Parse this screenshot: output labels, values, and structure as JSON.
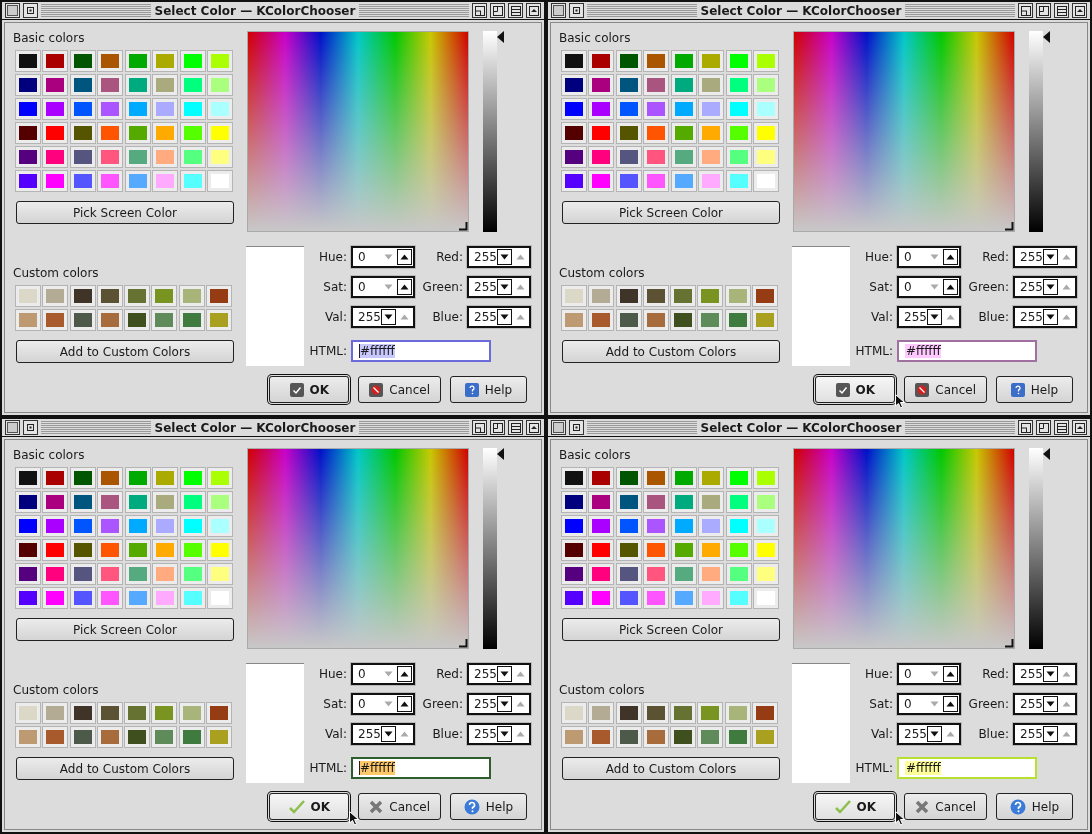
{
  "dialogs": [
    {
      "title": "Select Color — KColorChooser",
      "basic_label": "Basic colors",
      "basic_colors": [
        {
          "color": "#111111"
        },
        {
          "color": "#aa0000"
        },
        {
          "color": "#005500"
        },
        {
          "color": "#aa5500"
        },
        {
          "color": "#00aa00"
        },
        {
          "color": "#aaaa00"
        },
        {
          "color": "#00ff00"
        },
        {
          "color": "#aaff00"
        },
        {
          "color": "#00007f"
        },
        {
          "color": "#aa007f"
        },
        {
          "color": "#00557f"
        },
        {
          "color": "#aa557f"
        },
        {
          "color": "#00aa7f"
        },
        {
          "color": "#aaaa7f"
        },
        {
          "color": "#00ff7f"
        },
        {
          "color": "#aaff7f"
        },
        {
          "color": "#0000ff"
        },
        {
          "color": "#aa00ff"
        },
        {
          "color": "#0055ff"
        },
        {
          "color": "#aa55ff"
        },
        {
          "color": "#00aaff"
        },
        {
          "color": "#aaaaff"
        },
        {
          "color": "#00ffff"
        },
        {
          "color": "#aaffff"
        },
        {
          "color": "#550000"
        },
        {
          "color": "#ff0000"
        },
        {
          "color": "#555500"
        },
        {
          "color": "#ff5500"
        },
        {
          "color": "#55aa00"
        },
        {
          "color": "#ffaa00"
        },
        {
          "color": "#55ff00"
        },
        {
          "color": "#ffff00"
        },
        {
          "color": "#55007f"
        },
        {
          "color": "#ff007f"
        },
        {
          "color": "#55557f"
        },
        {
          "color": "#ff557f"
        },
        {
          "color": "#55aa7f"
        },
        {
          "color": "#ffaa7f"
        },
        {
          "color": "#55ff7f"
        },
        {
          "color": "#ffff7f"
        },
        {
          "color": "#5500ff"
        },
        {
          "color": "#ff00ff"
        },
        {
          "color": "#5555ff"
        },
        {
          "color": "#ff55ff"
        },
        {
          "color": "#55aaff"
        },
        {
          "color": "#ffaaff"
        },
        {
          "color": "#55ffff"
        },
        {
          "color": "#ffffff"
        }
      ],
      "pick_button": "Pick Screen Color",
      "value_slider": {
        "level": 1
      },
      "custom_label": "Custom colors",
      "custom_colors": [
        {
          "color": "#dcd8c8"
        },
        {
          "color": "#b3ab94"
        },
        {
          "color": "#3f3427"
        },
        {
          "color": "#5a5232"
        },
        {
          "color": "#667232"
        },
        {
          "color": "#7a9422"
        },
        {
          "color": "#a8b47a"
        },
        {
          "color": "#963c14"
        },
        {
          "color": "#bd9a72"
        },
        {
          "color": "#a85a2c"
        },
        {
          "color": "#4d5a4a"
        },
        {
          "color": "#a86c3c"
        },
        {
          "color": "#3f4f1e"
        },
        {
          "color": "#5f8a5a"
        },
        {
          "color": "#3f7a3f"
        },
        {
          "color": "#a8a01e"
        }
      ],
      "add_button": "Add to Custom Colors",
      "spins": [
        {
          "label": "Hue:",
          "value": "0",
          "down_disabled": true,
          "up_disabled": false
        },
        {
          "label": "Red:",
          "value": "255",
          "down_disabled": false,
          "up_disabled": true
        },
        {
          "label": "Sat:",
          "value": "0",
          "down_disabled": true,
          "up_disabled": false
        },
        {
          "label": "Green:",
          "value": "255",
          "down_disabled": false,
          "up_disabled": true
        },
        {
          "label": "Val:",
          "value": "255",
          "down_disabled": false,
          "up_disabled": true
        },
        {
          "label": "Blue:",
          "value": "255",
          "down_disabled": false,
          "up_disabled": true
        }
      ],
      "html": {
        "label": "HTML:",
        "value": "#ffffff",
        "focus": {
          "color": "#6b6bdc"
        },
        "selection": {
          "color": "#c8c8ff"
        },
        "caret": true
      },
      "buttons": [
        {
          "label": "OK",
          "kind": "ok",
          "default": true
        },
        {
          "label": "Cancel",
          "kind": "cancel",
          "default": false
        },
        {
          "label": "Help",
          "kind": "help",
          "default": false
        }
      ],
      "kind": "flat",
      "pointer_over_ok": false
    },
    {
      "title": "Select Color — KColorChooser",
      "basic_label": "Basic colors",
      "basic_colors": [
        {
          "color": "#111111"
        },
        {
          "color": "#aa0000"
        },
        {
          "color": "#005500"
        },
        {
          "color": "#aa5500"
        },
        {
          "color": "#00aa00"
        },
        {
          "color": "#aaaa00"
        },
        {
          "color": "#00ff00"
        },
        {
          "color": "#aaff00"
        },
        {
          "color": "#00007f"
        },
        {
          "color": "#aa007f"
        },
        {
          "color": "#00557f"
        },
        {
          "color": "#aa557f"
        },
        {
          "color": "#00aa7f"
        },
        {
          "color": "#aaaa7f"
        },
        {
          "color": "#00ff7f"
        },
        {
          "color": "#aaff7f"
        },
        {
          "color": "#0000ff"
        },
        {
          "color": "#aa00ff"
        },
        {
          "color": "#0055ff"
        },
        {
          "color": "#aa55ff"
        },
        {
          "color": "#00aaff"
        },
        {
          "color": "#aaaaff"
        },
        {
          "color": "#00ffff"
        },
        {
          "color": "#aaffff"
        },
        {
          "color": "#550000"
        },
        {
          "color": "#ff0000"
        },
        {
          "color": "#555500"
        },
        {
          "color": "#ff5500"
        },
        {
          "color": "#55aa00"
        },
        {
          "color": "#ffaa00"
        },
        {
          "color": "#55ff00"
        },
        {
          "color": "#ffff00"
        },
        {
          "color": "#55007f"
        },
        {
          "color": "#ff007f"
        },
        {
          "color": "#55557f"
        },
        {
          "color": "#ff557f"
        },
        {
          "color": "#55aa7f"
        },
        {
          "color": "#ffaa7f"
        },
        {
          "color": "#55ff7f"
        },
        {
          "color": "#ffff7f"
        },
        {
          "color": "#5500ff"
        },
        {
          "color": "#ff00ff"
        },
        {
          "color": "#5555ff"
        },
        {
          "color": "#ff55ff"
        },
        {
          "color": "#55aaff"
        },
        {
          "color": "#ffaaff"
        },
        {
          "color": "#55ffff"
        },
        {
          "color": "#ffffff"
        }
      ],
      "pick_button": "Pick Screen Color",
      "value_slider": {
        "level": 1
      },
      "custom_label": "Custom colors",
      "custom_colors": [
        {
          "color": "#dcd8c8"
        },
        {
          "color": "#b3ab94"
        },
        {
          "color": "#3f3427"
        },
        {
          "color": "#5a5232"
        },
        {
          "color": "#667232"
        },
        {
          "color": "#7a9422"
        },
        {
          "color": "#a8b47a"
        },
        {
          "color": "#963c14"
        },
        {
          "color": "#bd9a72"
        },
        {
          "color": "#a85a2c"
        },
        {
          "color": "#4d5a4a"
        },
        {
          "color": "#a86c3c"
        },
        {
          "color": "#3f4f1e"
        },
        {
          "color": "#5f8a5a"
        },
        {
          "color": "#3f7a3f"
        },
        {
          "color": "#a8a01e"
        }
      ],
      "add_button": "Add to Custom Colors",
      "spins": [
        {
          "label": "Hue:",
          "value": "0",
          "down_disabled": true,
          "up_disabled": false
        },
        {
          "label": "Red:",
          "value": "255",
          "down_disabled": false,
          "up_disabled": true
        },
        {
          "label": "Sat:",
          "value": "0",
          "down_disabled": true,
          "up_disabled": false
        },
        {
          "label": "Green:",
          "value": "255",
          "down_disabled": false,
          "up_disabled": true
        },
        {
          "label": "Val:",
          "value": "255",
          "down_disabled": false,
          "up_disabled": true
        },
        {
          "label": "Blue:",
          "value": "255",
          "down_disabled": false,
          "up_disabled": true
        }
      ],
      "html": {
        "label": "HTML:",
        "value": "#ffffff",
        "focus": {
          "color": "#a070a0"
        },
        "selection": {
          "color": "#ffc8ff"
        },
        "caret": false
      },
      "buttons": [
        {
          "label": "OK",
          "kind": "ok",
          "default": true
        },
        {
          "label": "Cancel",
          "kind": "cancel",
          "default": false
        },
        {
          "label": "Help",
          "kind": "help",
          "default": false
        }
      ],
      "kind": "flat",
      "pointer_over_ok": true
    },
    {
      "title": "Select Color — KColorChooser",
      "basic_label": "Basic colors",
      "basic_colors": [
        {
          "color": "#111111"
        },
        {
          "color": "#aa0000"
        },
        {
          "color": "#005500"
        },
        {
          "color": "#aa5500"
        },
        {
          "color": "#00aa00"
        },
        {
          "color": "#aaaa00"
        },
        {
          "color": "#00ff00"
        },
        {
          "color": "#aaff00"
        },
        {
          "color": "#00007f"
        },
        {
          "color": "#aa007f"
        },
        {
          "color": "#00557f"
        },
        {
          "color": "#aa557f"
        },
        {
          "color": "#00aa7f"
        },
        {
          "color": "#aaaa7f"
        },
        {
          "color": "#00ff7f"
        },
        {
          "color": "#aaff7f"
        },
        {
          "color": "#0000ff"
        },
        {
          "color": "#aa00ff"
        },
        {
          "color": "#0055ff"
        },
        {
          "color": "#aa55ff"
        },
        {
          "color": "#00aaff"
        },
        {
          "color": "#aaaaff"
        },
        {
          "color": "#00ffff"
        },
        {
          "color": "#aaffff"
        },
        {
          "color": "#550000"
        },
        {
          "color": "#ff0000"
        },
        {
          "color": "#555500"
        },
        {
          "color": "#ff5500"
        },
        {
          "color": "#55aa00"
        },
        {
          "color": "#ffaa00"
        },
        {
          "color": "#55ff00"
        },
        {
          "color": "#ffff00"
        },
        {
          "color": "#55007f"
        },
        {
          "color": "#ff007f"
        },
        {
          "color": "#55557f"
        },
        {
          "color": "#ff557f"
        },
        {
          "color": "#55aa7f"
        },
        {
          "color": "#ffaa7f"
        },
        {
          "color": "#55ff7f"
        },
        {
          "color": "#ffff7f"
        },
        {
          "color": "#5500ff"
        },
        {
          "color": "#ff00ff"
        },
        {
          "color": "#5555ff"
        },
        {
          "color": "#ff55ff"
        },
        {
          "color": "#55aaff"
        },
        {
          "color": "#ffaaff"
        },
        {
          "color": "#55ffff"
        },
        {
          "color": "#ffffff"
        }
      ],
      "pick_button": "Pick Screen Color",
      "value_slider": {
        "level": 1
      },
      "custom_label": "Custom colors",
      "custom_colors": [
        {
          "color": "#dcd8c8"
        },
        {
          "color": "#b3ab94"
        },
        {
          "color": "#3f3427"
        },
        {
          "color": "#5a5232"
        },
        {
          "color": "#667232"
        },
        {
          "color": "#7a9422"
        },
        {
          "color": "#a8b47a"
        },
        {
          "color": "#963c14"
        },
        {
          "color": "#bd9a72"
        },
        {
          "color": "#a85a2c"
        },
        {
          "color": "#4d5a4a"
        },
        {
          "color": "#a86c3c"
        },
        {
          "color": "#3f4f1e"
        },
        {
          "color": "#5f8a5a"
        },
        {
          "color": "#3f7a3f"
        },
        {
          "color": "#a8a01e"
        }
      ],
      "add_button": "Add to Custom Colors",
      "spins": [
        {
          "label": "Hue:",
          "value": "0",
          "down_disabled": true,
          "up_disabled": false
        },
        {
          "label": "Red:",
          "value": "255",
          "down_disabled": false,
          "up_disabled": true
        },
        {
          "label": "Sat:",
          "value": "0",
          "down_disabled": true,
          "up_disabled": false
        },
        {
          "label": "Green:",
          "value": "255",
          "down_disabled": false,
          "up_disabled": true
        },
        {
          "label": "Val:",
          "value": "255",
          "down_disabled": false,
          "up_disabled": true
        },
        {
          "label": "Blue:",
          "value": "255",
          "down_disabled": false,
          "up_disabled": true
        }
      ],
      "html": {
        "label": "HTML:",
        "value": "#ffffff",
        "focus": {
          "color": "#2e5e2e"
        },
        "selection": {
          "color": "#ffc868"
        },
        "caret": true
      },
      "buttons": [
        {
          "label": "OK",
          "kind": "ok",
          "default": true
        },
        {
          "label": "Cancel",
          "kind": "cancel",
          "default": false
        },
        {
          "label": "Help",
          "kind": "help",
          "default": false
        }
      ],
      "kind": "round",
      "pointer_over_ok": true
    },
    {
      "title": "Select Color — KColorChooser",
      "basic_label": "Basic colors",
      "basic_colors": [
        {
          "color": "#111111"
        },
        {
          "color": "#aa0000"
        },
        {
          "color": "#005500"
        },
        {
          "color": "#aa5500"
        },
        {
          "color": "#00aa00"
        },
        {
          "color": "#aaaa00"
        },
        {
          "color": "#00ff00"
        },
        {
          "color": "#aaff00"
        },
        {
          "color": "#00007f"
        },
        {
          "color": "#aa007f"
        },
        {
          "color": "#00557f"
        },
        {
          "color": "#aa557f"
        },
        {
          "color": "#00aa7f"
        },
        {
          "color": "#aaaa7f"
        },
        {
          "color": "#00ff7f"
        },
        {
          "color": "#aaff7f"
        },
        {
          "color": "#0000ff"
        },
        {
          "color": "#aa00ff"
        },
        {
          "color": "#0055ff"
        },
        {
          "color": "#aa55ff"
        },
        {
          "color": "#00aaff"
        },
        {
          "color": "#aaaaff"
        },
        {
          "color": "#00ffff"
        },
        {
          "color": "#aaffff"
        },
        {
          "color": "#550000"
        },
        {
          "color": "#ff0000"
        },
        {
          "color": "#555500"
        },
        {
          "color": "#ff5500"
        },
        {
          "color": "#55aa00"
        },
        {
          "color": "#ffaa00"
        },
        {
          "color": "#55ff00"
        },
        {
          "color": "#ffff00"
        },
        {
          "color": "#55007f"
        },
        {
          "color": "#ff007f"
        },
        {
          "color": "#55557f"
        },
        {
          "color": "#ff557f"
        },
        {
          "color": "#55aa7f"
        },
        {
          "color": "#ffaa7f"
        },
        {
          "color": "#55ff7f"
        },
        {
          "color": "#ffff7f"
        },
        {
          "color": "#5500ff"
        },
        {
          "color": "#ff00ff"
        },
        {
          "color": "#5555ff"
        },
        {
          "color": "#ff55ff"
        },
        {
          "color": "#55aaff"
        },
        {
          "color": "#ffaaff"
        },
        {
          "color": "#55ffff"
        },
        {
          "color": "#ffffff"
        }
      ],
      "pick_button": "Pick Screen Color",
      "value_slider": {
        "level": 1
      },
      "custom_label": "Custom colors",
      "custom_colors": [
        {
          "color": "#dcd8c8"
        },
        {
          "color": "#b3ab94"
        },
        {
          "color": "#3f3427"
        },
        {
          "color": "#5a5232"
        },
        {
          "color": "#667232"
        },
        {
          "color": "#7a9422"
        },
        {
          "color": "#a8b47a"
        },
        {
          "color": "#963c14"
        },
        {
          "color": "#bd9a72"
        },
        {
          "color": "#a85a2c"
        },
        {
          "color": "#4d5a4a"
        },
        {
          "color": "#a86c3c"
        },
        {
          "color": "#3f4f1e"
        },
        {
          "color": "#5f8a5a"
        },
        {
          "color": "#3f7a3f"
        },
        {
          "color": "#a8a01e"
        }
      ],
      "add_button": "Add to Custom Colors",
      "spins": [
        {
          "label": "Hue:",
          "value": "0",
          "down_disabled": true,
          "up_disabled": false
        },
        {
          "label": "Red:",
          "value": "255",
          "down_disabled": false,
          "up_disabled": true
        },
        {
          "label": "Sat:",
          "value": "0",
          "down_disabled": true,
          "up_disabled": false
        },
        {
          "label": "Green:",
          "value": "255",
          "down_disabled": false,
          "up_disabled": true
        },
        {
          "label": "Val:",
          "value": "255",
          "down_disabled": false,
          "up_disabled": true
        },
        {
          "label": "Blue:",
          "value": "255",
          "down_disabled": false,
          "up_disabled": true
        }
      ],
      "html": {
        "label": "HTML:",
        "value": "#ffffff",
        "focus": {
          "color": "#b8e030"
        },
        "selection": {
          "color": "#ffff99"
        },
        "caret": false
      },
      "buttons": [
        {
          "label": "OK",
          "kind": "ok",
          "default": true
        },
        {
          "label": "Cancel",
          "kind": "cancel",
          "default": false
        },
        {
          "label": "Help",
          "kind": "help",
          "default": false
        }
      ],
      "kind": "round",
      "pointer_over_ok": true
    }
  ]
}
